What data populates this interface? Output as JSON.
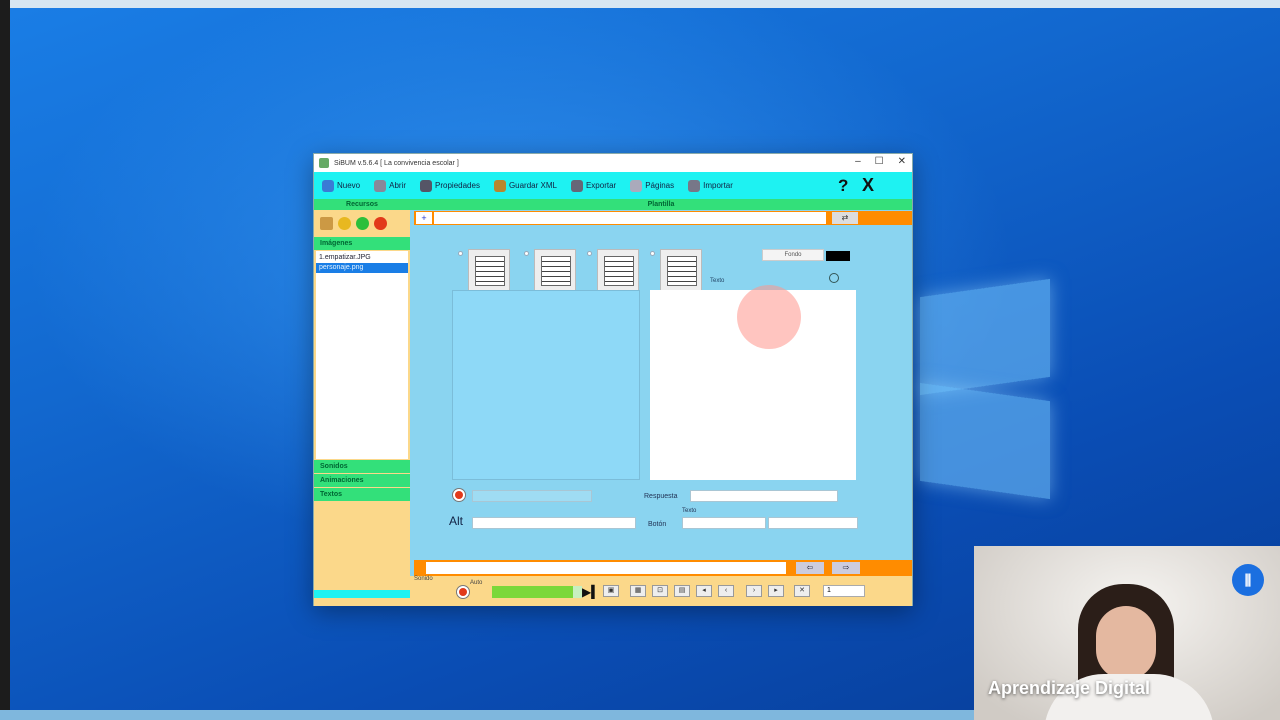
{
  "window": {
    "title": "SiBUM  v.5.6.4   [ La convivencia escolar ]",
    "controls": [
      "–",
      "☐",
      "✕"
    ]
  },
  "toolbar": {
    "items": [
      {
        "label": "Nuevo",
        "icon": "new-icon"
      },
      {
        "label": "Abrir",
        "icon": "open-icon"
      },
      {
        "label": "Propiedades",
        "icon": "properties-icon"
      },
      {
        "label": "Guardar XML",
        "icon": "save-icon"
      },
      {
        "label": "Exportar",
        "icon": "export-icon"
      },
      {
        "label": "Páginas",
        "icon": "pages-icon"
      },
      {
        "label": "Importar",
        "icon": "import-icon"
      }
    ],
    "help": "?",
    "close": "X"
  },
  "left_panel": {
    "header": "Recursos",
    "images_header": "Imágenes",
    "images": [
      {
        "name": "1.empatizar.JPG",
        "selected": false
      },
      {
        "name": "personaje.png",
        "selected": true
      }
    ],
    "categories": [
      "Sonidos",
      "Animaciones",
      "Textos"
    ]
  },
  "main": {
    "header": "Plantilla",
    "add_button": "+",
    "fondo_button": "Fondo",
    "texto_label": "Texto",
    "respuesta_label": "Respuesta",
    "alt_label": "Alt",
    "boton_label": "Botón",
    "texto_small_label": "Texto",
    "colors": {
      "swatch": "#000000",
      "accent": "#ff8c00",
      "header_green": "#33e07a",
      "toolbar_cyan": "#1ef2f2"
    }
  },
  "playbar": {
    "sonido_label": "Sonido",
    "auto_label": "Auto",
    "progress": 0.9,
    "page_number": "1"
  },
  "webcam": {
    "caption": "Aprendizaje Digital"
  }
}
